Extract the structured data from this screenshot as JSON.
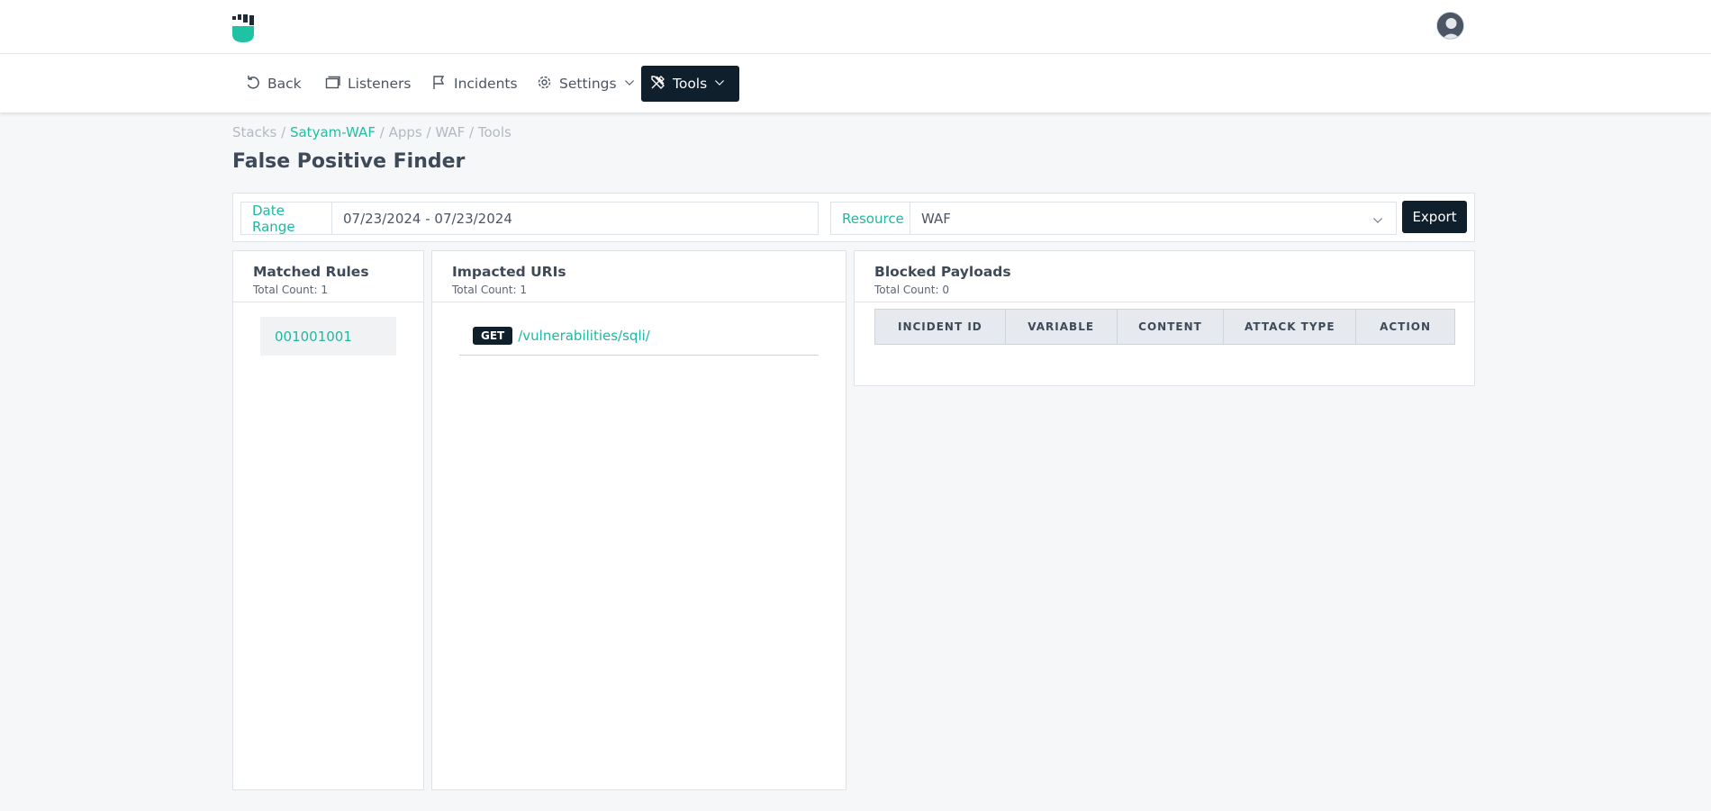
{
  "header": {
    "logo_icon": "fist-logo-icon",
    "avatar_icon": "user-avatar-icon"
  },
  "nav": {
    "items": [
      {
        "label": "Back",
        "icon": "undo-icon"
      },
      {
        "label": "Listeners",
        "icon": "listeners-icon"
      },
      {
        "label": "Incidents",
        "icon": "flag-icon"
      },
      {
        "label": "Settings",
        "icon": "gear-icon"
      },
      {
        "label": "Tools",
        "icon": "tools-icon"
      }
    ],
    "active": "Tools"
  },
  "breadcrumb": {
    "stacks": "Stacks",
    "sep": "/",
    "stack_name": "Satyam-WAF",
    "apps": "Apps",
    "waf": "WAF",
    "tools": "Tools"
  },
  "page": {
    "title": "False Positive Finder"
  },
  "filters": {
    "date_label": "Date Range",
    "date_value": "07/23/2024 - 07/23/2024",
    "resource_label": "Resource",
    "resource_value": "WAF",
    "export_label": "Export"
  },
  "matched_rules": {
    "title": "Matched Rules",
    "total": "Total Count: 1",
    "items": [
      "001001001"
    ]
  },
  "impacted_uris": {
    "title": "Impacted URIs",
    "total": "Total Count: 1",
    "items": [
      {
        "method": "GET",
        "uri": "/vulnerabilities/sqli/"
      }
    ]
  },
  "blocked_payloads": {
    "title": "Blocked Payloads",
    "total": "Total Count: 0",
    "columns": [
      "INCIDENT ID",
      "VARIABLE",
      "CONTENT",
      "ATTACK TYPE",
      "ACTION"
    ]
  },
  "colors": {
    "accent": "#20b8a0",
    "dark": "#0f1f2b"
  }
}
